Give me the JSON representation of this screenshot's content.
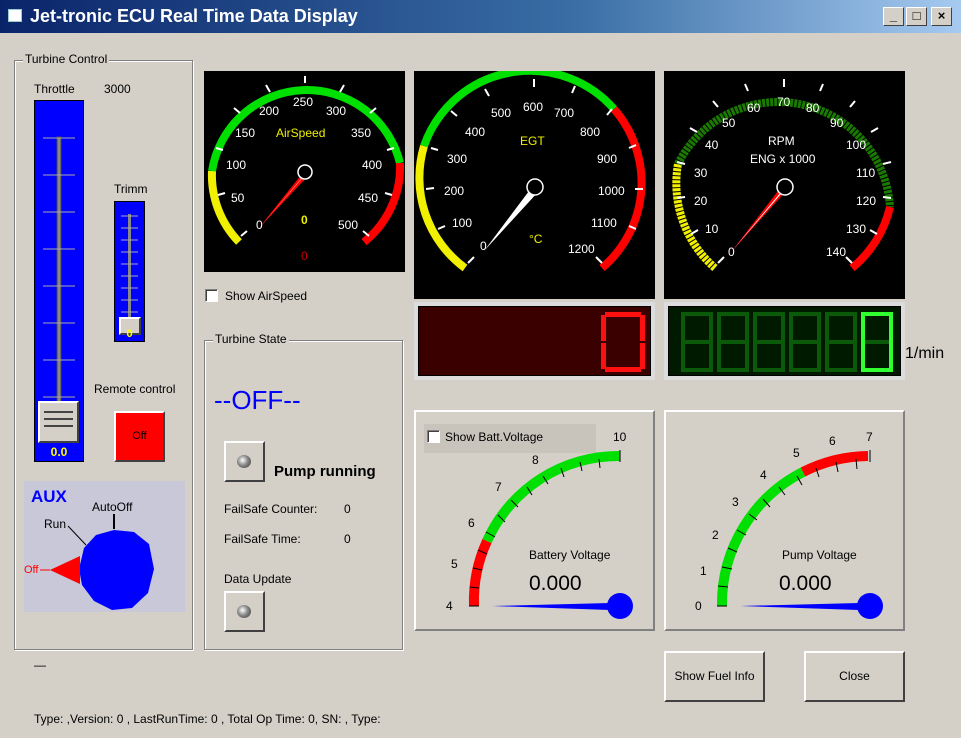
{
  "window": {
    "title": "Jet-tronic ECU Real Time Data Display",
    "minimize_glyph": "_",
    "maximize_glyph": "□",
    "close_glyph": "×"
  },
  "turbine_control": {
    "group_label": "Turbine Control",
    "throttle_label": "Throttle",
    "throttle_max_label": "3000",
    "throttle_value": "0.0",
    "trimm_label": "Trimm",
    "trimm_value": "0",
    "remote_control_label": "Remote control",
    "remote_button_label": "Off",
    "remote_button_color": "#ff0000",
    "aux": {
      "title": "AUX",
      "off_label": "Off",
      "run_label": "Run",
      "autooff_label": "AutoOff",
      "knob_color": "#0000ff",
      "pointer_color": "#ff0000"
    },
    "dash_label": "—"
  },
  "gauges": {
    "airspeed": {
      "label": "AirSpeed",
      "ticks": [
        "0",
        "50",
        "100",
        "150",
        "200",
        "250",
        "300",
        "350",
        "400",
        "450",
        "500"
      ],
      "value": "0",
      "value2": "0",
      "show_label": "Show AirSpeed",
      "show_checked": false
    },
    "egt": {
      "label": "EGT",
      "unit": "°C",
      "ticks": [
        "0",
        "100",
        "200",
        "300",
        "400",
        "500",
        "600",
        "700",
        "800",
        "900",
        "1000",
        "1100",
        "1200"
      ],
      "digital_value": "0"
    },
    "rpm": {
      "label": "RPM",
      "sublabel": "ENG x 1000",
      "ticks": [
        "0",
        "10",
        "20",
        "30",
        "40",
        "50",
        "60",
        "70",
        "80",
        "90",
        "100",
        "110",
        "120",
        "130",
        "140"
      ],
      "digital_value": "0",
      "unit": "1/min"
    },
    "battery": {
      "show_label": "Show Batt.Voltage",
      "show_checked": false,
      "ticks": [
        "4",
        "5",
        "6",
        "7",
        "8",
        "10"
      ],
      "label": "Battery Voltage",
      "value": "0.000"
    },
    "pump": {
      "ticks": [
        "0",
        "1",
        "2",
        "3",
        "4",
        "5",
        "6",
        "7"
      ],
      "label": "Pump Voltage",
      "value": "0.000"
    }
  },
  "turbine_state": {
    "group_label": "Turbine State",
    "state": "--OFF--",
    "pump_label": "Pump running",
    "failsafe_counter_label": "FailSafe Counter:",
    "failsafe_counter_value": "0",
    "failsafe_time_label": "FailSafe Time:",
    "failsafe_time_value": "0",
    "data_update_label": "Data Update"
  },
  "buttons": {
    "show_fuel_info": "Show Fuel Info",
    "close": "Close"
  },
  "status_bar": "Type: ,Version:  0 , LastRunTime: 0 , Total Op Time:  0, SN: , Type:",
  "colors": {
    "green": "#00e000",
    "yellow": "#f0f000",
    "red": "#ff0000",
    "dark_green": "#1a7a00",
    "throttle_blue": "#0000ff"
  }
}
